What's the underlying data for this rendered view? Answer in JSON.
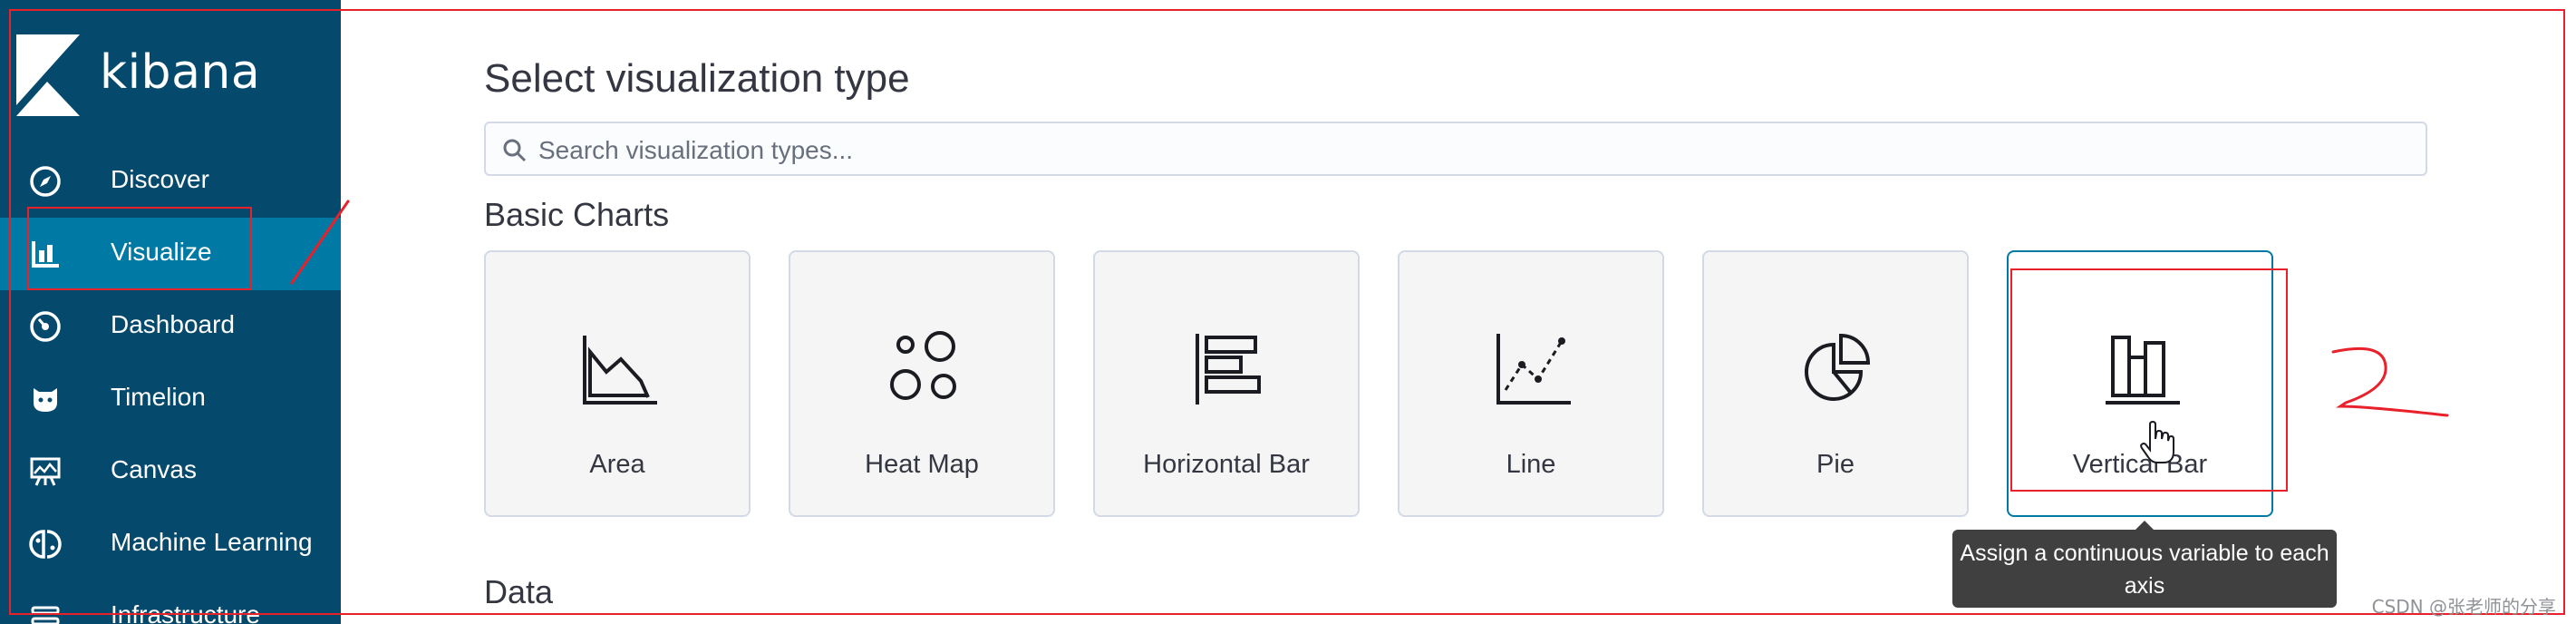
{
  "brand": {
    "name": "kibana"
  },
  "nav": {
    "items": [
      {
        "label": "Discover",
        "icon": "compass-icon",
        "active": false
      },
      {
        "label": "Visualize",
        "icon": "bar-chart-icon",
        "active": true
      },
      {
        "label": "Dashboard",
        "icon": "dashboard-icon",
        "active": false
      },
      {
        "label": "Timelion",
        "icon": "timelion-icon",
        "active": false
      },
      {
        "label": "Canvas",
        "icon": "canvas-icon",
        "active": false
      },
      {
        "label": "Machine Learning",
        "icon": "machine-learning-icon",
        "active": false
      },
      {
        "label": "Infrastructure",
        "icon": "infrastructure-icon",
        "active": false
      }
    ]
  },
  "main": {
    "title": "Select visualization type",
    "search": {
      "placeholder": "Search visualization types..."
    },
    "sections": {
      "basic": "Basic Charts",
      "data": "Data"
    },
    "cards": [
      {
        "label": "Area",
        "icon": "area-chart-icon"
      },
      {
        "label": "Heat Map",
        "icon": "heat-map-icon"
      },
      {
        "label": "Horizontal Bar",
        "icon": "horizontal-bar-icon"
      },
      {
        "label": "Line",
        "icon": "line-chart-icon"
      },
      {
        "label": "Pie",
        "icon": "pie-chart-icon"
      },
      {
        "label": "Vertical Bar",
        "icon": "vertical-bar-icon",
        "hovered": true
      }
    ],
    "tooltip": "Assign a continuous variable to each axis"
  },
  "annotations": {
    "mark_1": "1",
    "mark_2": "2"
  },
  "watermark": "CSDN @张老师的分享",
  "colors": {
    "sidebar": "#054a6d",
    "active_nav": "#0079a5",
    "annotation_red": "#e8212b",
    "tooltip_bg": "#404040"
  }
}
